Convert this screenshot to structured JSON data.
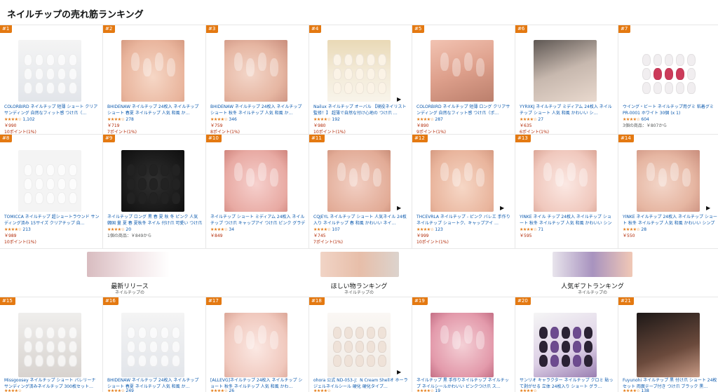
{
  "page_title": "ネイルチップの売れ筋ランキング",
  "row1": [
    {
      "rank": "#1",
      "title": "COLORBIRD ネイルチップ 短薄 ショート クリアサンディング 自然なフィット感 つけ爪（…",
      "stars": "★★★★☆",
      "count": "1,102",
      "price": "￥990",
      "points": "10ポイント(1%)",
      "play": false,
      "img": "img-tray-clear"
    },
    {
      "rank": "#2",
      "title": "BHIDENAW ネイルチップ 24枚入 ネイルチップ ショート 春夏 ネイルチップ 人気 和風 か…",
      "stars": "★★★★☆",
      "count": "278",
      "price": "￥719",
      "points": "7ポイント(1%)",
      "play": false,
      "img": "img-nude"
    },
    {
      "rank": "#3",
      "title": "BHIDENAW ネイルチップ 24枚入 ネイルチップ ショート 秋冬 ネイルチップ 人気 和風 か…",
      "stars": "★★★★☆",
      "count": "346",
      "price": "￥759",
      "points": "8ポイント(1%)",
      "play": false,
      "img": "img-french"
    },
    {
      "rank": "#4",
      "title": "Nailux ネイルチップ オーバル 【現役ネイリスト監修！】 超薄で自然な付け心地の つけ爪 …",
      "stars": "★★★★☆",
      "count": "192",
      "price": "￥980",
      "points": "10ポイント(1%)",
      "play": true,
      "img": "img-box"
    },
    {
      "rank": "#5",
      "title": "COLORBIRD ネイルチップ 短薄 ロング クリアサンディング 自然なフィット感 つけ爪（ポ…",
      "stars": "★★★★☆",
      "count": "287",
      "price": "￥890",
      "points": "9ポイント(1%)",
      "play": false,
      "img": "img-clear-hand"
    },
    {
      "rank": "#6",
      "title": "YYRXKJ ネイルチップ ミディアム 24枚入 ネイルチップ ショート 人気 和風 かわいい シ…",
      "stars": "★★★★☆",
      "count": "27",
      "price": "￥635",
      "points": "6ポイント(1%)",
      "play": false,
      "img": "img-grey"
    },
    {
      "rank": "#7",
      "title": "ウイング・ビート ネイルチップ用グミ 粘着グミ PR-0001 ホワイト 30個 (x 1)",
      "stars": "★★★★☆",
      "count": "604",
      "price": "3個の商品：￥807から",
      "points": "",
      "play": false,
      "img": "img-gummy"
    }
  ],
  "row2": [
    {
      "rank": "#8",
      "title": "TOMICCA ネイルチップ 超ショートラウンド サンディング済み 15サイズ クリアチップ 自…",
      "stars": "★★★★☆",
      "count": "213",
      "price": "￥989",
      "points": "10ポイント(1%)",
      "play": false,
      "img": "img-square"
    },
    {
      "rank": "#9",
      "title": "ネイルチップ ロング 黒 春 夏 秋 冬 ピンク 人気 韓国 量 夏 春 夏秋冬 ネイル 付け爪 可愛い つけ爪 人気 3D おしゃれ 入学式 卒業式 成人式 結婚式 …",
      "stars": "★★★★☆",
      "count": "20",
      "price": "1個の商品：￥849から",
      "points": "",
      "play": false,
      "img": "img-black"
    },
    {
      "rank": "#10",
      "title": "ネイルチップ ショート ミディアム 24枚入 ネイル チップ つけ爪 キャップアイ つけ爪 ピンク グラデーション 肌色 人気 和風 可愛い シ…",
      "stars": "★★★★☆",
      "count": "34",
      "price": "￥849",
      "points": "",
      "play": false,
      "img": "img-pink"
    },
    {
      "rank": "#11",
      "title": "CQJEYL ネイルチップ ショート 人気ネイル 24枚入り ネイルチップ 春 和風 かわいい ネイ…",
      "stars": "★★★★☆",
      "count": "107",
      "price": "￥745",
      "points": "7ポイント(1%)",
      "play": true,
      "img": "img-sheer"
    },
    {
      "rank": "#12",
      "title": "THCEVRLA ネイルチップ - ピンク バレエ 手作りネイルチップ ショートク、キャップアイ …",
      "stars": "★★★★☆",
      "count": "123",
      "price": "￥999",
      "points": "10ポイント(1%)",
      "play": true,
      "img": "img-nude"
    },
    {
      "rank": "#13",
      "title": "YINKE ネイル チップ 24枚入 ネイルチップ ショート 秋冬 ネイルチップ 人気 和風 かわいい シンプル おしゃれ ショート春夏秋冬 花…",
      "stars": "★★★★☆",
      "count": "71",
      "price": "￥595",
      "points": "",
      "play": false,
      "img": "img-pinkbeige"
    },
    {
      "rank": "#14",
      "title": "YINKE ネイルチップ 24枚入 ネイルチップ ショート 秋冬 ネイルチップ 人気 和風 かわいい シンプル 人気 ネイルシール 女性おしゃれ…",
      "stars": "★★★★☆",
      "count": "28",
      "price": "￥550",
      "points": "",
      "play": true,
      "img": "img-french"
    }
  ],
  "promos": [
    {
      "title": "最新リリース",
      "sub": "ネイルチップの",
      "img": "img-promo1"
    },
    {
      "title": "ほしい物ランキング",
      "sub": "ネイルチップの",
      "img": "img-promo2"
    },
    {
      "title": "人気ギフトランキング",
      "sub": "ネイルチップの",
      "img": "img-promo3"
    }
  ],
  "row3": [
    {
      "rank": "#15",
      "title": "Missgoosey ネイルチップ ショート バレリーナ サンディング済みネイルチップ 300枚セット…",
      "stars": "★★★★☆",
      "count": "",
      "play": false,
      "img": "img-coffin"
    },
    {
      "rank": "#16",
      "title": "BHIDENAW ネイルチップ 24枚入 ネイルチップ ショート 春夏 ネイルチップ 人気 和風 か…",
      "stars": "★★★★☆",
      "count": "249",
      "play": false,
      "img": "img-tray-clear"
    },
    {
      "rank": "#17",
      "title": "[ALLEVG]ネイルチップ 24枚入 ネイルチップ ショート 秋冬 ネイルチップ 人気 和風 かわ…",
      "stars": "★★★★☆",
      "count": "26",
      "play": false,
      "img": "img-pinkbeige"
    },
    {
      "rank": "#18",
      "title": "ohora 公式 ND-053-J：N Cream Shellオ ホーラ ジェルネイルシール 硬化 硬化タイプ…",
      "stars": "★★★★☆",
      "count": "",
      "play": true,
      "img": "img-ohora"
    },
    {
      "rank": "#19",
      "title": "ネイルチップ 黒 手作りネイルチップ ネイルチップ ネイルシールかわいい ピンクつけ爪 ス…",
      "stars": "★★★★☆",
      "count": "19",
      "play": false,
      "img": "img-marble"
    },
    {
      "rank": "#20",
      "title": "サンリオ キャラクター ネイルチップ クロミ 貼って剥がせる 立体 24枚入り ショート グラ…",
      "stars": "★★★★☆",
      "count": "",
      "play": false,
      "img": "img-purple"
    },
    {
      "rank": "#21",
      "title": "Fuyunohi ネイルチップ 黒 付け爪 ショート 24枚セット 両面テープ付き つけ爪 ブラック 黒…",
      "stars": "★★★★☆",
      "count": "138",
      "play": false,
      "img": "img-dark"
    }
  ]
}
